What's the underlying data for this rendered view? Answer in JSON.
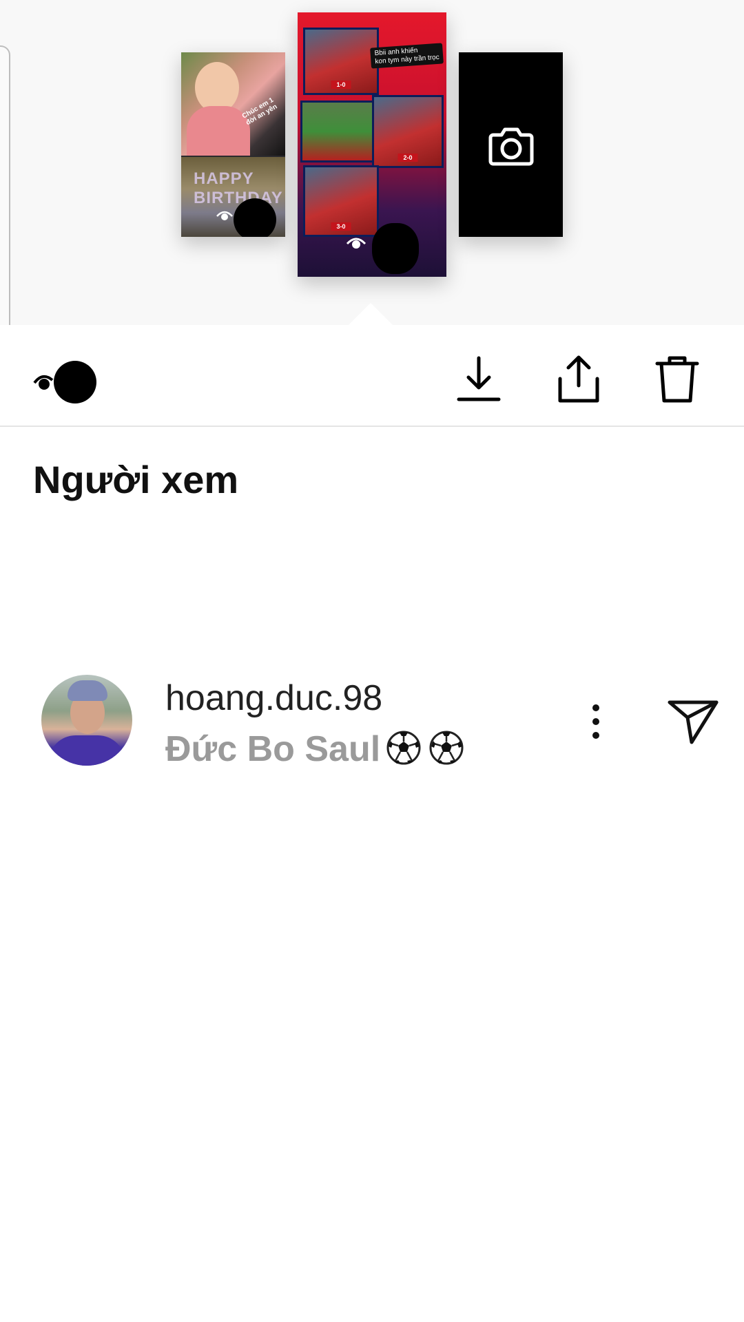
{
  "gallery": {
    "thumbnails": [
      {
        "name": "story-thumbnail-birthday",
        "caption": "Chúc em 1 đời an yên",
        "overlay_text": "HAPPY BIRTHDAY"
      },
      {
        "name": "story-thumbnail-football",
        "caption_line1": "Bbii anh khiến",
        "caption_line2": "kon tym này trần trọc",
        "scores": [
          "1-0",
          "2-0",
          "3-0"
        ]
      },
      {
        "name": "add-story-camera"
      }
    ]
  },
  "actions": {
    "download": "download-icon",
    "share": "share-icon",
    "delete": "trash-icon"
  },
  "viewers_section": {
    "title": "Người xem",
    "viewers": [
      {
        "username": "hoang.duc.98",
        "full_name": "Đức Bo Saul",
        "emoji_count": 2
      }
    ]
  },
  "colors": {
    "accent_story_red": "#c8102e",
    "secondary_text": "#9a9a9a"
  }
}
